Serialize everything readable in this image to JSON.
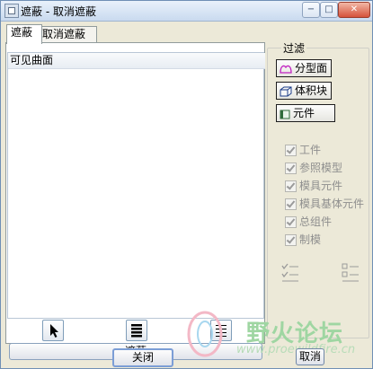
{
  "window": {
    "title": "遮蔽 - 取消遮蔽",
    "controls": {
      "minimize": "−",
      "maximize": "□",
      "close": "✕"
    }
  },
  "tabs": [
    {
      "label": "遮蔽",
      "active": true
    },
    {
      "label": "取消遮蔽",
      "active": false
    }
  ],
  "list": {
    "header": "可见曲面",
    "items": []
  },
  "panel_buttons": [
    {
      "icon": "arrow-cursor-icon"
    },
    {
      "icon": "select-all-icon"
    },
    {
      "icon": "deselect-all-icon"
    }
  ],
  "action_button": "遮蔽",
  "filter": {
    "label": "过滤",
    "buttons": [
      {
        "label": "分型面",
        "icon": "parting-surface-icon"
      },
      {
        "label": "体积块",
        "icon": "volume-icon"
      },
      {
        "label": "元件",
        "icon": "component-icon"
      }
    ],
    "checkboxes": [
      {
        "label": "工件",
        "checked": true
      },
      {
        "label": "参照模型",
        "checked": true
      },
      {
        "label": "模具元件",
        "checked": true
      },
      {
        "label": "模具基体元件",
        "checked": true
      },
      {
        "label": "总组件",
        "checked": true
      },
      {
        "label": "制模",
        "checked": true
      }
    ],
    "icons": [
      "select-all-check-icon",
      "deselect-all-check-icon"
    ]
  },
  "footer": {
    "close": "关闭",
    "cancel": "取消"
  },
  "watermark": {
    "text": "野火论坛",
    "url": "www.proewildfire.cn"
  }
}
